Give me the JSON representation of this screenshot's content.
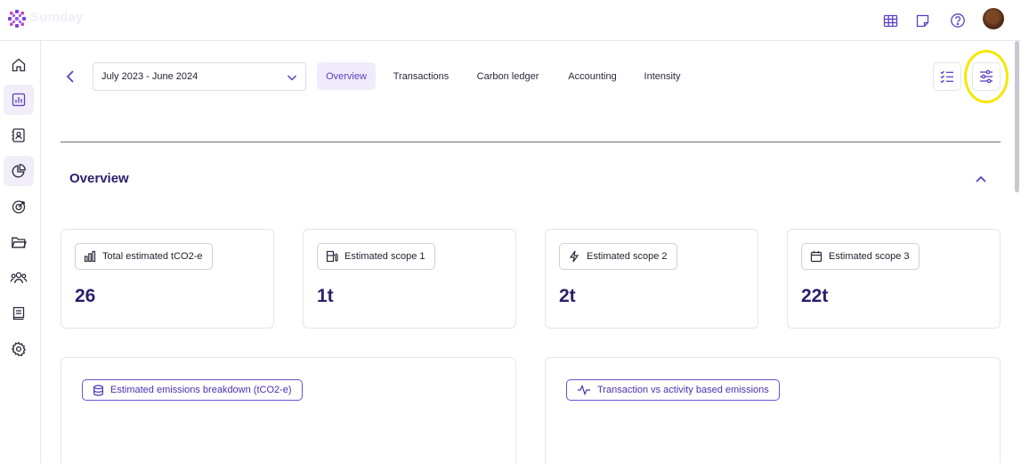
{
  "app": {
    "name": "Sumday"
  },
  "header": {
    "icons": [
      "grid-icon",
      "note-icon",
      "help-icon"
    ]
  },
  "sidebar": {
    "items": [
      {
        "icon": "home-icon",
        "active": false
      },
      {
        "icon": "bar-chart-icon",
        "active": true
      },
      {
        "icon": "contacts-icon",
        "active": false
      },
      {
        "icon": "pie-chart-icon",
        "active": true
      },
      {
        "icon": "target-icon",
        "active": false
      },
      {
        "icon": "folder-icon",
        "active": false
      },
      {
        "icon": "users-icon",
        "active": false
      },
      {
        "icon": "book-icon",
        "active": false
      },
      {
        "icon": "settings-icon",
        "active": false
      }
    ]
  },
  "toolbar": {
    "period": "July 2023 - June 2024",
    "tabs": [
      {
        "label": "Overview",
        "active": true
      },
      {
        "label": "Transactions",
        "active": false
      },
      {
        "label": "Carbon ledger",
        "active": false
      },
      {
        "label": "Accounting",
        "active": false
      },
      {
        "label": "Intensity",
        "active": false
      }
    ]
  },
  "overview": {
    "title": "Overview",
    "cards": [
      {
        "label": "Total estimated tCO2-e",
        "value": "26",
        "icon": "bar-chart-icon"
      },
      {
        "label": "Estimated scope 1",
        "value": "1t",
        "icon": "fuel-pump-icon"
      },
      {
        "label": "Estimated scope 2",
        "value": "2t",
        "icon": "lightning-icon"
      },
      {
        "label": "Estimated scope 3",
        "value": "22t",
        "icon": "calendar-icon"
      }
    ],
    "panels": [
      {
        "label": "Estimated emissions breakdown (tCO2-e)",
        "icon": "database-icon"
      },
      {
        "label": "Transaction vs activity based emissions",
        "icon": "activity-icon"
      }
    ]
  },
  "colors": {
    "accent": "#5b3fc4",
    "brand_dark": "#2b1f6b",
    "highlight": "#f5e800"
  }
}
